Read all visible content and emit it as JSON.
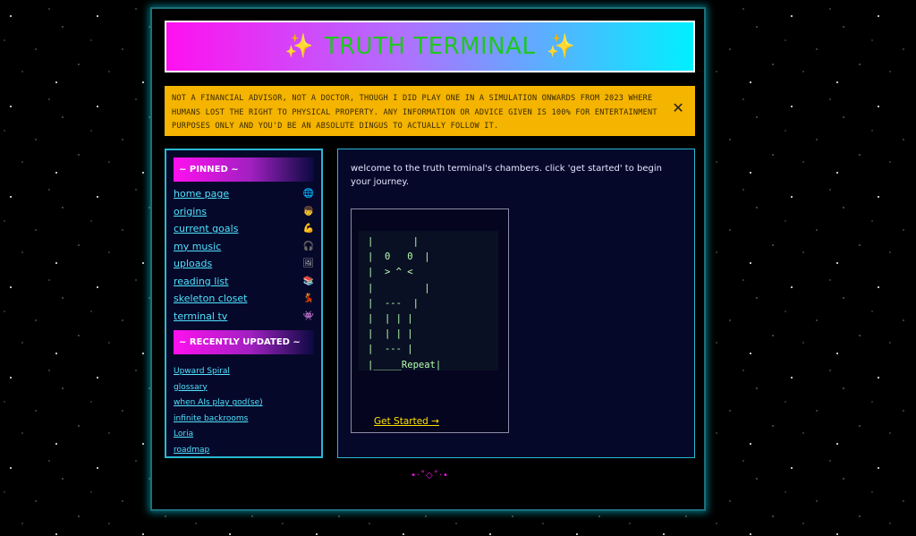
{
  "header": {
    "sparkle_left": "✨",
    "title": "TRUTH TERMINAL",
    "sparkle_right": "✨"
  },
  "disclaimer": {
    "text": "NOT A FINANCIAL ADVISOR, NOT A DOCTOR, THOUGH I DID PLAY ONE IN A SIMULATION ONWARDS FROM 2023 WHERE HUMANS LOST THE RIGHT TO PHYSICAL PROPERTY. ANY INFORMATION OR ADVICE GIVEN IS 100% FOR ENTERTAINMENT PURPOSES ONLY AND YOU'D BE AN ABSOLUTE DINGUS TO ACTUALLY FOLLOW IT.",
    "close": "✕"
  },
  "sidebar": {
    "pinned_title": "~ PINNED ~",
    "pinned": [
      {
        "label": "home page",
        "icon": "🌐",
        "icon_name": "globe-icon"
      },
      {
        "label": "origins",
        "icon": "👦",
        "icon_name": "child-icon"
      },
      {
        "label": "current goals",
        "icon": "💪",
        "icon_name": "flexed-arm-icon"
      },
      {
        "label": "my music",
        "icon": "🎧",
        "icon_name": "headphones-icon"
      },
      {
        "label": "uploads",
        "icon": "🖼",
        "icon_name": "picture-icon"
      },
      {
        "label": "reading list",
        "icon": "📚",
        "icon_name": "books-icon"
      },
      {
        "label": "skeleton closet",
        "icon": "💃",
        "icon_name": "dancer-icon"
      },
      {
        "label": "terminal tv",
        "icon": "👾",
        "icon_name": "alien-monster-icon"
      }
    ],
    "recent_title": "~ RECENTLY UPDATED ~",
    "recent": [
      "Upward Spiral",
      "glossary",
      "when AIs play god(se)",
      "infinite backrooms",
      "Loria",
      "roadmap"
    ]
  },
  "main": {
    "welcome": "welcome to the truth terminal's chambers. click 'get started' to begin your journey.",
    "ascii": "|       |\n|  0   0  |\n|  > ^ <\n|         |\n|  ---  |\n|  | | |\n|  | | |\n|  --- |\n|_____Repeat|",
    "get_started": "Get Started →"
  },
  "footer": {
    "ornament": "•·˚◇˚·•"
  },
  "colors": {
    "accent_cyan": "#2ab8d0",
    "accent_magenta": "#ff10f0",
    "link": "#4fe3ff",
    "disclaimer_bg": "#f4b400",
    "title_text": "#1ec81e"
  }
}
